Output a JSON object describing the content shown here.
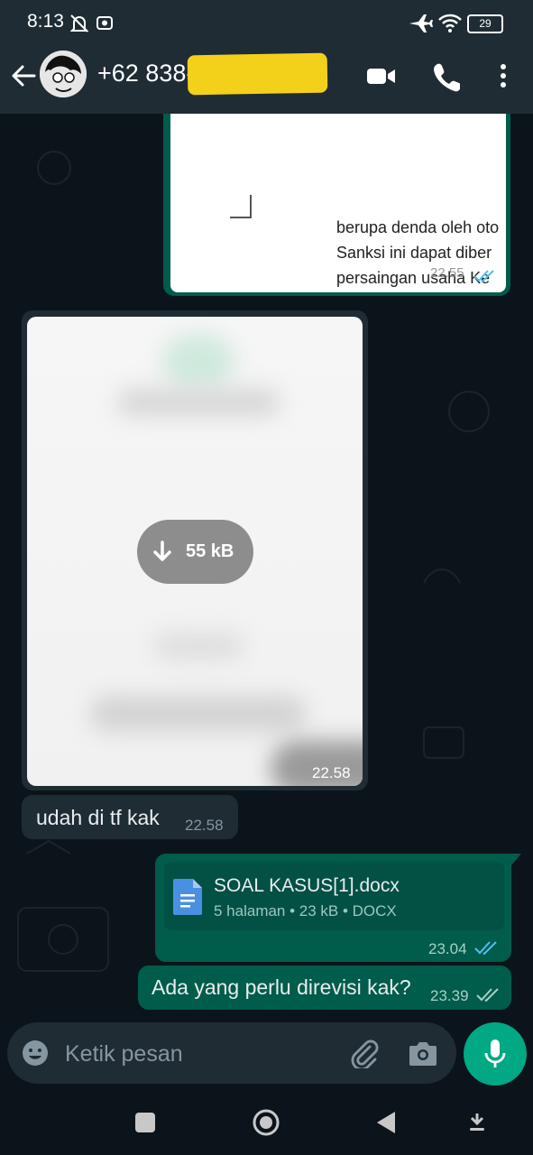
{
  "status_bar": {
    "time": "8:13",
    "battery": "29",
    "icons": [
      "mute-icon",
      "notification-icon",
      "airplane-icon",
      "wifi-icon",
      "battery-icon"
    ]
  },
  "header": {
    "contact_name": "+62 838-",
    "icons": [
      "back-arrow-icon",
      "avatar",
      "video-call-icon",
      "voice-call-icon",
      "more-options-icon"
    ]
  },
  "messages": [
    {
      "type": "image-outgoing",
      "preview_lines": [
        "berupa denda oleh oto",
        "Sanksi ini dapat diber",
        "persaingan usaha Ke"
      ],
      "time": "22.55"
    },
    {
      "type": "image-incoming",
      "download_size": "55 kB",
      "time": "22.58"
    },
    {
      "type": "text-incoming",
      "text": "udah di tf kak",
      "time": "22.58"
    },
    {
      "type": "document-outgoing",
      "file_name": "SOAL KASUS[1].docx",
      "file_meta": "5 halaman • 23 kB • DOCX",
      "time": "23.04"
    },
    {
      "type": "text-outgoing",
      "text": "Ada yang perlu direvisi kak?",
      "time": "23.39"
    }
  ],
  "composer": {
    "placeholder": "Ketik pesan"
  },
  "colors": {
    "background": "#0b141a",
    "bar": "#1f2c34",
    "outgoing_bubble": "#005c4b",
    "accent": "#00a884",
    "read_ticks": "#53bdeb"
  }
}
